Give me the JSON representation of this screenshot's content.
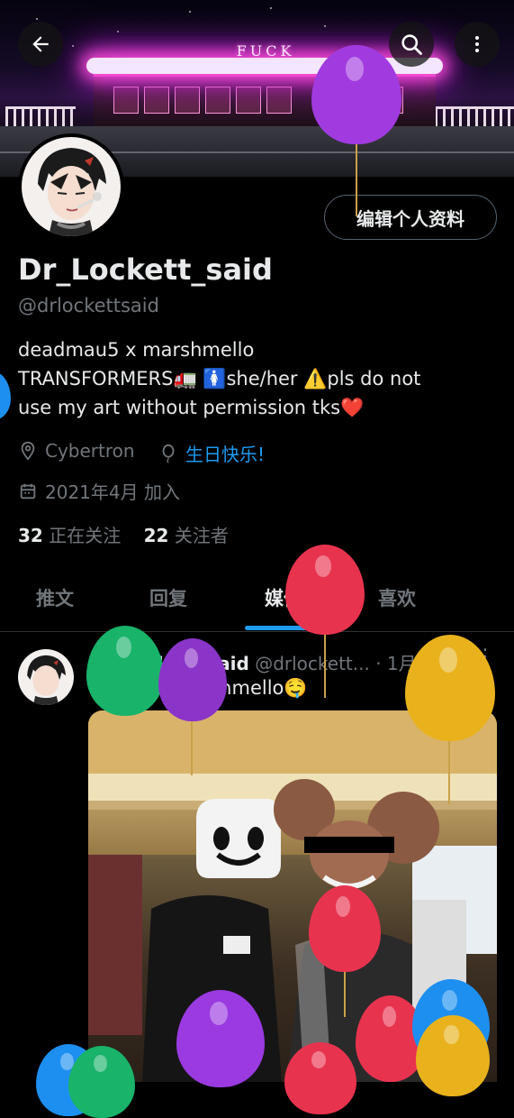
{
  "banner": {
    "sign_text": "FUCK"
  },
  "top_bar": {
    "back_icon": "arrow-left-icon",
    "search_icon": "search-icon",
    "more_icon": "more-vertical-icon"
  },
  "profile": {
    "edit_button_label": "编辑个人资料",
    "display_name": "Dr_Lockett_said",
    "handle": "@drlockettsaid",
    "bio_line1": "deadmau5 x marshmello",
    "bio_line2": "TRANSFORMERS🚛    🚺she/her ⚠️pls do not",
    "bio_line3": "use my art without permission tks❤️",
    "location": "Cybertron",
    "birthday": "生日快乐!",
    "joined": "2021年4月 加入",
    "following_count": "32",
    "following_label": "正在关注",
    "followers_count": "22",
    "followers_label": "关注者"
  },
  "tabs": [
    {
      "label": "推文"
    },
    {
      "label": "回复"
    },
    {
      "label": "媒体"
    },
    {
      "label": "喜欢"
    }
  ],
  "tweet": {
    "name": "Dr_Lockett_said",
    "handle": "@drlockett...",
    "time": "· 1月2日",
    "text": "me with marshmello🤤"
  },
  "colors": {
    "accent": "#1d9bf0",
    "background": "#000000",
    "muted": "#71767b"
  }
}
